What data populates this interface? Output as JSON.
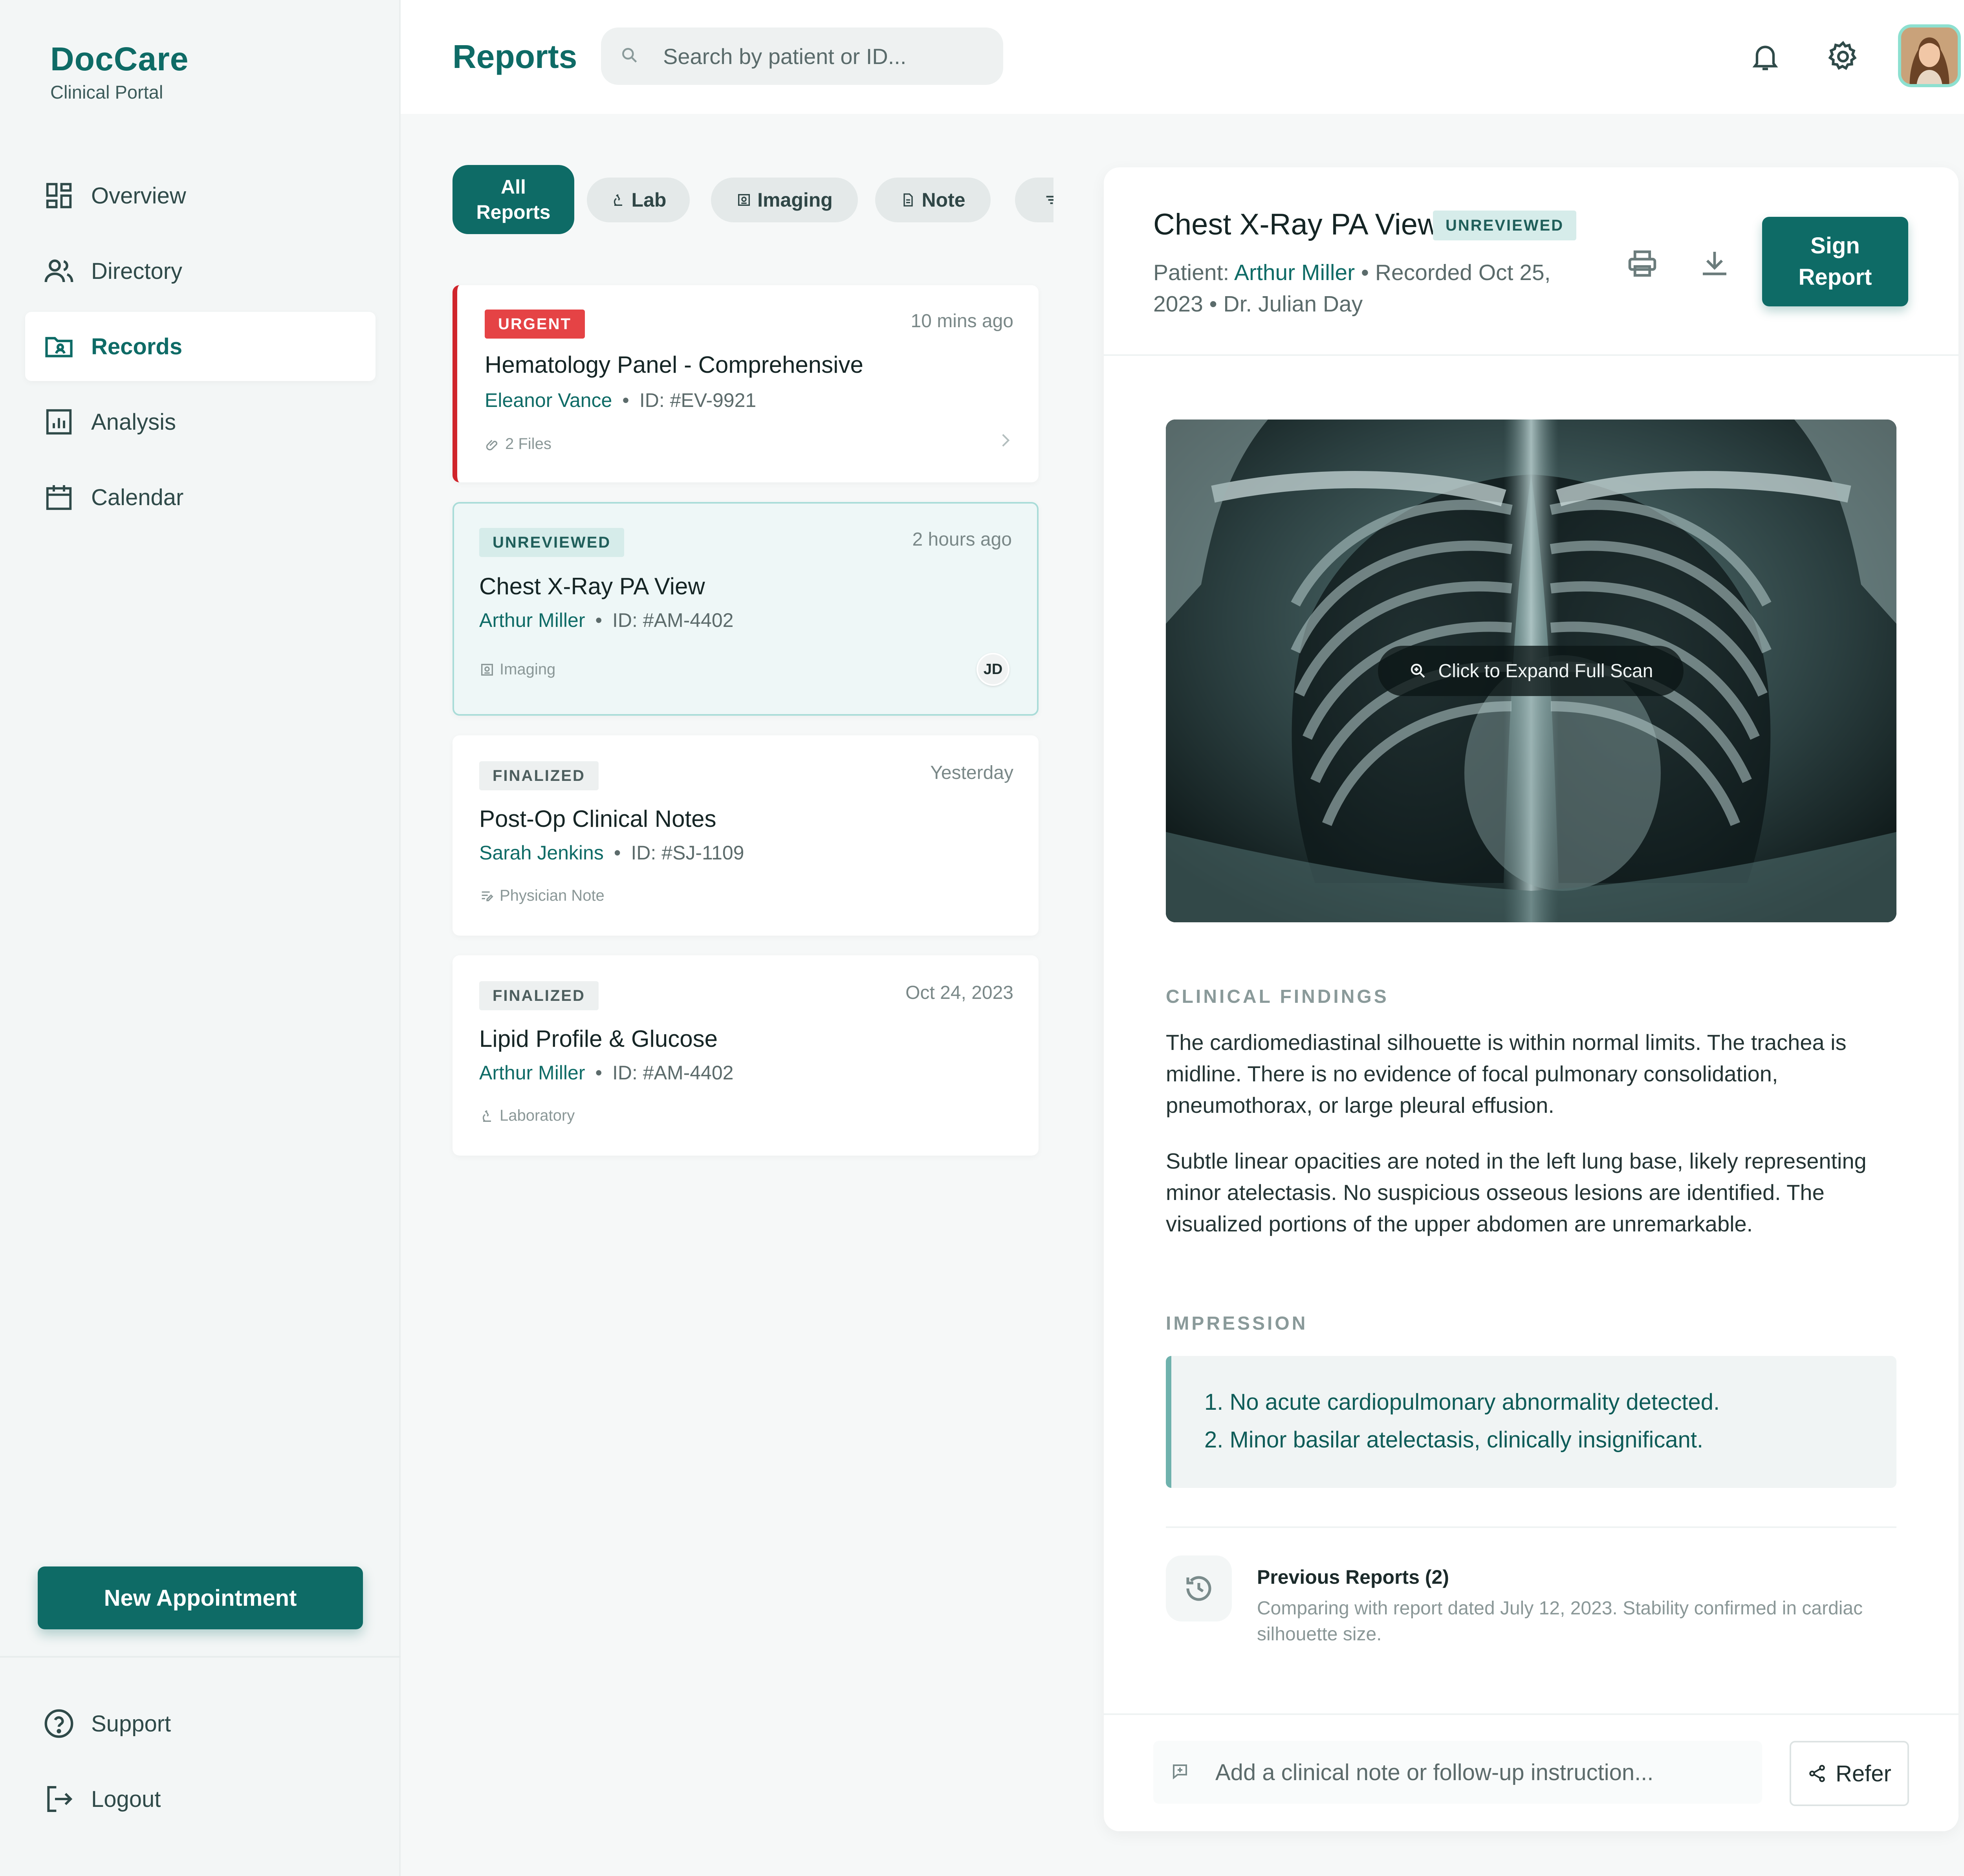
{
  "brand": {
    "name": "DocCare",
    "subtitle": "Clinical Portal"
  },
  "sidebar": {
    "items": [
      {
        "label": "Overview",
        "icon": "dashboard-icon"
      },
      {
        "label": "Directory",
        "icon": "users-icon"
      },
      {
        "label": "Records",
        "icon": "folder-user-icon",
        "active": true
      },
      {
        "label": "Analysis",
        "icon": "bar-chart-icon"
      },
      {
        "label": "Calendar",
        "icon": "calendar-icon"
      }
    ],
    "new_appointment": "New Appointment",
    "bottom": [
      {
        "label": "Support",
        "icon": "help-circle-icon"
      },
      {
        "label": "Logout",
        "icon": "logout-icon"
      }
    ]
  },
  "header": {
    "title": "Reports",
    "search_placeholder": "Search by patient or ID...",
    "icons": [
      "bell-icon",
      "gear-icon",
      "avatar"
    ]
  },
  "filters": {
    "items": [
      {
        "label": "All Reports",
        "active": true
      },
      {
        "label": "Lab",
        "icon": "microscope-icon"
      },
      {
        "label": "Imaging",
        "icon": "image-icon"
      },
      {
        "label": "Note",
        "icon": "document-icon"
      }
    ],
    "more_icon": "filter-icon"
  },
  "reports": [
    {
      "status": "URGENT",
      "time": "10 mins ago",
      "title": "Hematology Panel - Comprehensive",
      "patient": "Eleanor Vance",
      "id": "ID: #EV-9921",
      "foot": "2 Files",
      "foot_icon": "attachment-icon"
    },
    {
      "status": "UNREVIEWED",
      "time": "2 hours ago",
      "title": "Chest X-Ray PA View",
      "patient": "Arthur Miller",
      "id": "ID: #AM-4402",
      "foot": "Imaging",
      "foot_icon": "image-icon",
      "assignee": "JD"
    },
    {
      "status": "FINALIZED",
      "time": "Yesterday",
      "title": "Post-Op Clinical Notes",
      "patient": "Sarah Jenkins",
      "id": "ID: #SJ-1109",
      "foot": "Physician Note",
      "foot_icon": "note-edit-icon"
    },
    {
      "status": "FINALIZED",
      "time": "Oct 24, 2023",
      "title": "Lipid Profile & Glucose",
      "patient": "Arthur Miller",
      "id": "ID: #AM-4402",
      "foot": "Laboratory",
      "foot_icon": "microscope-icon"
    }
  ],
  "detail": {
    "title": "Chest X-Ray PA View",
    "badge": "UNREVIEWED",
    "patient_prefix": "Patient: ",
    "patient": "Arthur Miller",
    "sub_rest": " • Recorded Oct 25, 2023 • Dr. Julian Day",
    "sign_button": "Sign Report",
    "expand_label": "Click to Expand Full Scan",
    "findings_label": "CLINICAL FINDINGS",
    "findings_1": "The cardiomediastinal silhouette is within normal limits. The trachea is midline. There is no evidence of focal pulmonary consolidation, pneumothorax, or large pleural effusion.",
    "findings_2": "Subtle linear opacities are noted in the left lung base, likely representing minor atelectasis. No suspicious osseous lesions are identified. The visualized portions of the upper abdomen are unremarkable.",
    "impression_label": "IMPRESSION",
    "impression": [
      "1. No acute cardiopulmonary abnormality detected.",
      "2. Minor basilar atelectasis, clinically insignificant."
    ],
    "previous_title": "Previous Reports (2)",
    "previous_text": "Comparing with report dated July 12, 2023. Stability confirmed in cardiac silhouette size.",
    "note_placeholder": "Add a clinical note or follow-up instruction...",
    "refer_button": "Refer"
  }
}
